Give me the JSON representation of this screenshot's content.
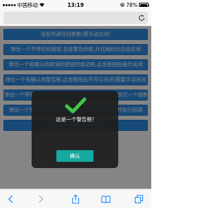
{
  "status_bar": {
    "carrier": "中国移动",
    "network": "",
    "time": "13:19",
    "battery": "78%"
  },
  "page_buttons": [
    "没有传递任何参数(需手动关闭)",
    "弹出一个不带任何按钮,且是警告的框,并且两秒后自动关闭",
    "弹出一个有确认的取消的按钮的成功框,点击按钮后操作关闭",
    "弹出一个有确认的警告框,点击按钮后不可以关闭(需要手动关闭",
    "弹出一个带有确认的错误框,点击按钮的时候关闭并执行一个函数",
    "弹出一个带有确认的错误框,点击按钮的时候关闭并执行回调",
    "弹出一个有确认的问题框"
  ],
  "dialog": {
    "icon": "check-icon",
    "message": "这是一个警告框!",
    "ok_label": "确认"
  },
  "colors": {
    "button_blue": "#2f8fe8",
    "ok_teal": "#16a9a1",
    "check_green": "#3cc84a"
  }
}
